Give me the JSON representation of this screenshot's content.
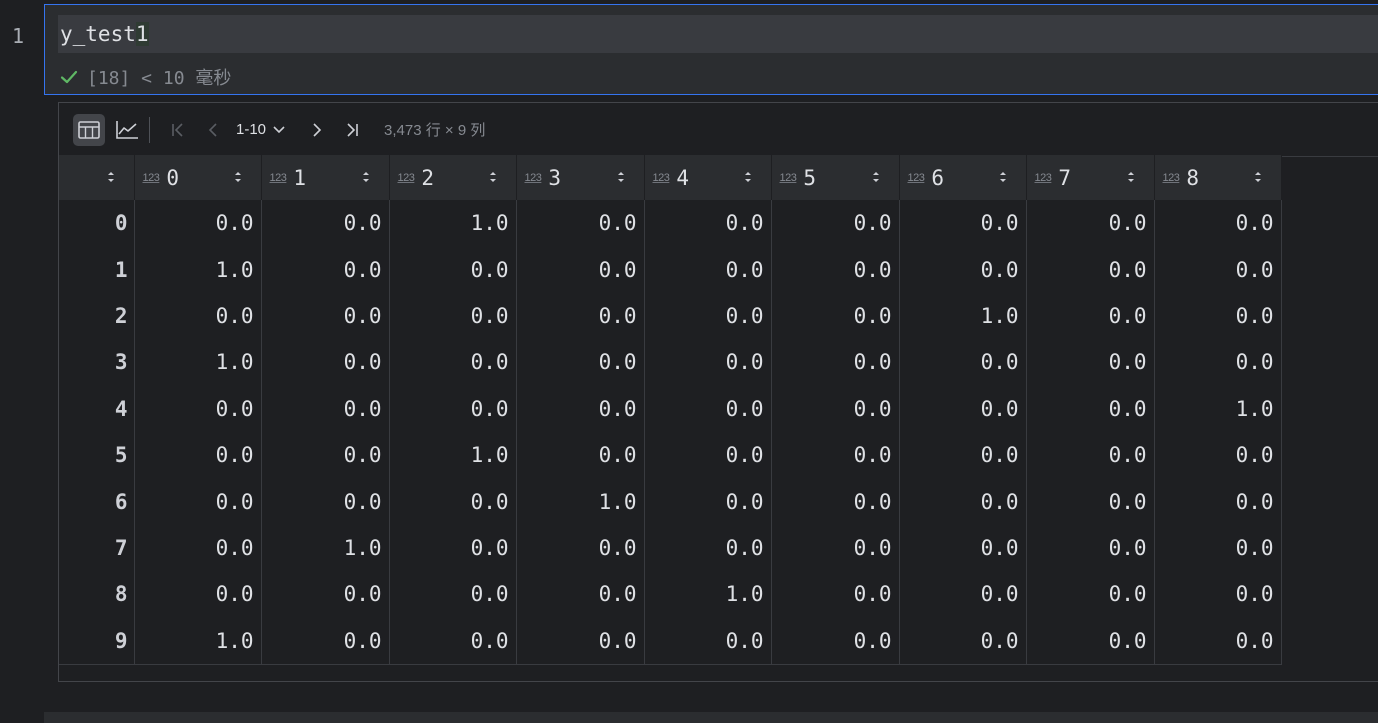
{
  "editor": {
    "line_number": "1",
    "code_prefix": "y_test",
    "code_selected": "1"
  },
  "execution": {
    "status_text": "[18] < 10 毫秒",
    "status_color": "#5fb865"
  },
  "toolbar": {
    "view_table_icon": "table-icon",
    "view_chart_icon": "line-chart-icon",
    "page_range": "1-10",
    "row_info": "3,473 行 × 9 列"
  },
  "table": {
    "columns": [
      {
        "type": "123",
        "name": "0"
      },
      {
        "type": "123",
        "name": "1"
      },
      {
        "type": "123",
        "name": "2"
      },
      {
        "type": "123",
        "name": "3"
      },
      {
        "type": "123",
        "name": "4"
      },
      {
        "type": "123",
        "name": "5"
      },
      {
        "type": "123",
        "name": "6"
      },
      {
        "type": "123",
        "name": "7"
      },
      {
        "type": "123",
        "name": "8"
      }
    ],
    "rows": [
      {
        "index": "0",
        "values": [
          "0.0",
          "0.0",
          "1.0",
          "0.0",
          "0.0",
          "0.0",
          "0.0",
          "0.0",
          "0.0"
        ]
      },
      {
        "index": "1",
        "values": [
          "1.0",
          "0.0",
          "0.0",
          "0.0",
          "0.0",
          "0.0",
          "0.0",
          "0.0",
          "0.0"
        ]
      },
      {
        "index": "2",
        "values": [
          "0.0",
          "0.0",
          "0.0",
          "0.0",
          "0.0",
          "0.0",
          "1.0",
          "0.0",
          "0.0"
        ]
      },
      {
        "index": "3",
        "values": [
          "1.0",
          "0.0",
          "0.0",
          "0.0",
          "0.0",
          "0.0",
          "0.0",
          "0.0",
          "0.0"
        ]
      },
      {
        "index": "4",
        "values": [
          "0.0",
          "0.0",
          "0.0",
          "0.0",
          "0.0",
          "0.0",
          "0.0",
          "0.0",
          "1.0"
        ]
      },
      {
        "index": "5",
        "values": [
          "0.0",
          "0.0",
          "1.0",
          "0.0",
          "0.0",
          "0.0",
          "0.0",
          "0.0",
          "0.0"
        ]
      },
      {
        "index": "6",
        "values": [
          "0.0",
          "0.0",
          "0.0",
          "1.0",
          "0.0",
          "0.0",
          "0.0",
          "0.0",
          "0.0"
        ]
      },
      {
        "index": "7",
        "values": [
          "0.0",
          "1.0",
          "0.0",
          "0.0",
          "0.0",
          "0.0",
          "0.0",
          "0.0",
          "0.0"
        ]
      },
      {
        "index": "8",
        "values": [
          "0.0",
          "0.0",
          "0.0",
          "0.0",
          "1.0",
          "0.0",
          "0.0",
          "0.0",
          "0.0"
        ]
      },
      {
        "index": "9",
        "values": [
          "1.0",
          "0.0",
          "0.0",
          "0.0",
          "0.0",
          "0.0",
          "0.0",
          "0.0",
          "0.0"
        ]
      }
    ]
  }
}
